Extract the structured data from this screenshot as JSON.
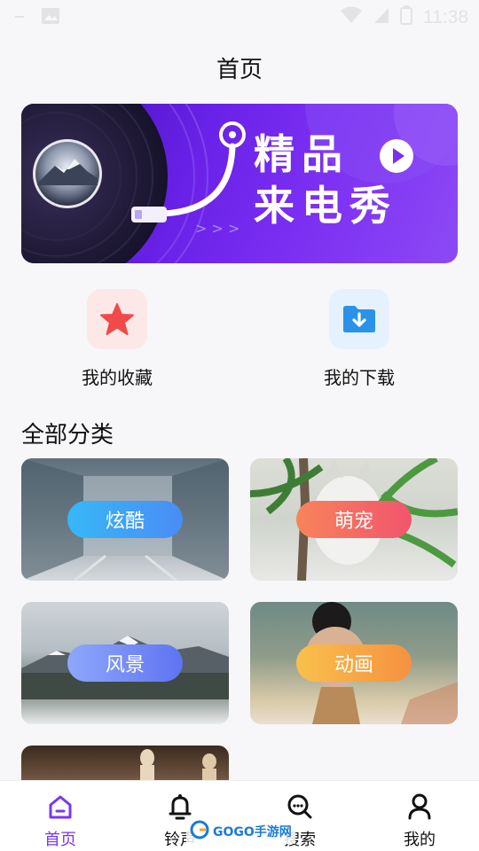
{
  "status_bar": {
    "time": "11:38"
  },
  "header": {
    "title": "首页"
  },
  "banner": {
    "line1": "精品",
    "line2": "来电秀",
    "arrows": "> > >"
  },
  "quick_actions": [
    {
      "label": "我的收藏",
      "icon": "star-icon",
      "color": "#f04a4a"
    },
    {
      "label": "我的下载",
      "icon": "download-folder-icon",
      "color": "#2a93e8"
    }
  ],
  "categories_section": {
    "title": "全部分类",
    "items": [
      {
        "label": "炫酷"
      },
      {
        "label": "萌宠"
      },
      {
        "label": "风景"
      },
      {
        "label": "动画"
      }
    ]
  },
  "tabbar": {
    "active_color": "#7a36f0",
    "items": [
      {
        "label": "首页",
        "icon": "home-icon",
        "active": true
      },
      {
        "label": "铃声",
        "icon": "bell-icon",
        "active": false
      },
      {
        "label": "搜索",
        "icon": "search-icon",
        "active": false
      },
      {
        "label": "我的",
        "icon": "user-icon",
        "active": false
      }
    ]
  },
  "watermark": {
    "text": "GOGO手游网"
  }
}
